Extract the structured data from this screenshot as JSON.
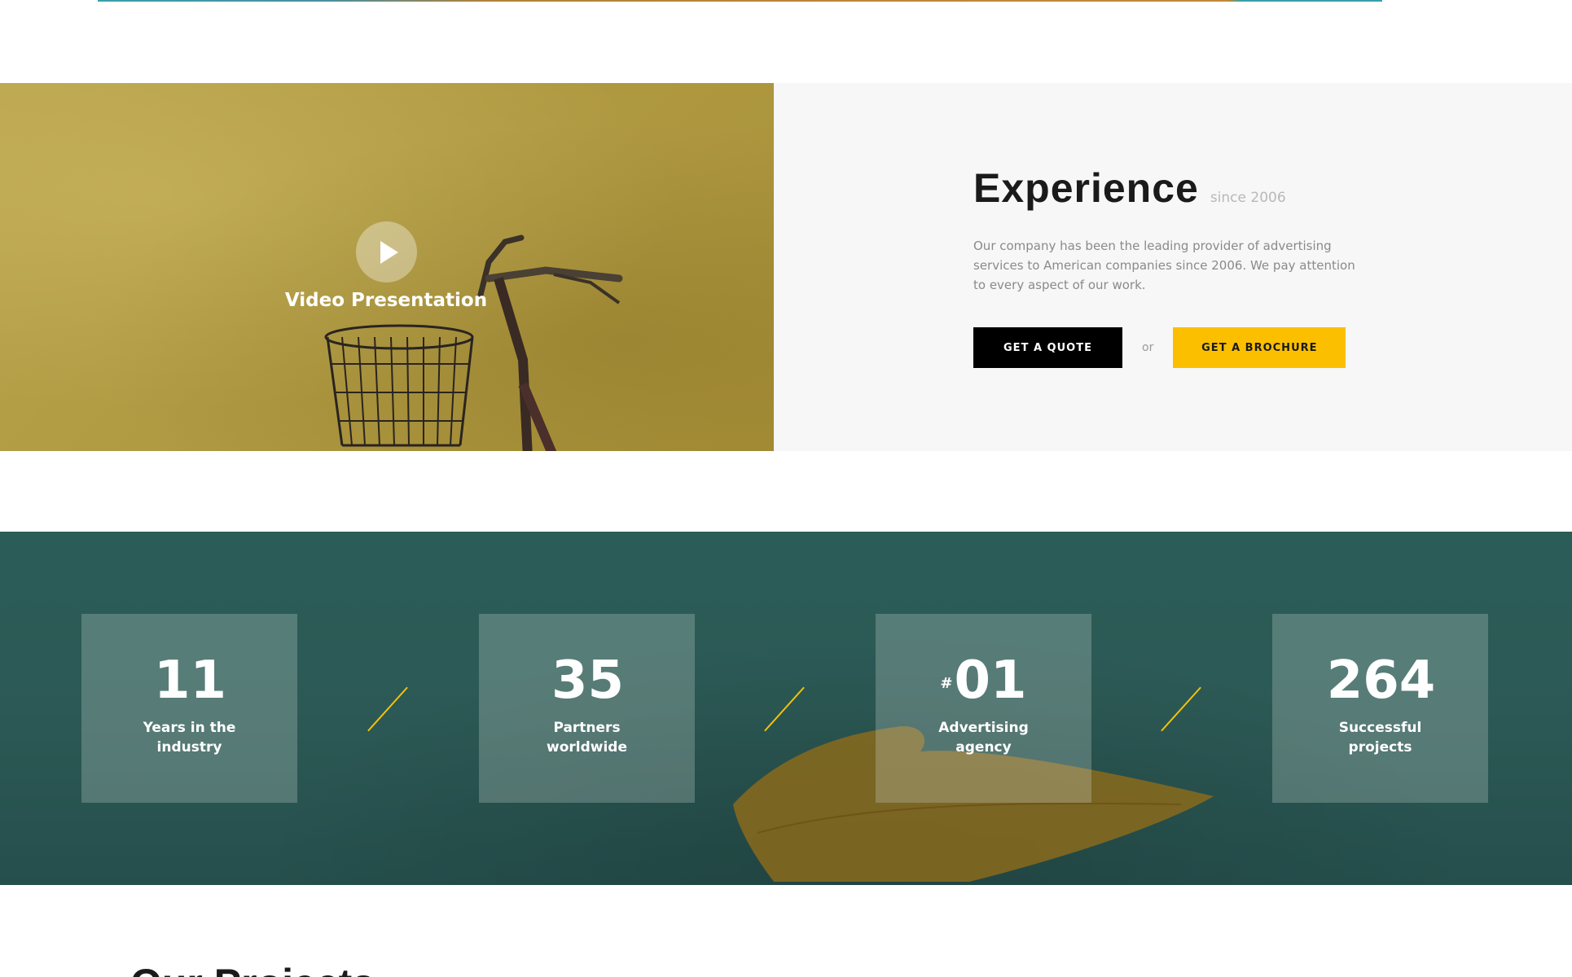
{
  "video": {
    "label": "Video Presentation",
    "play_icon": "play-icon"
  },
  "experience": {
    "title": "Experience",
    "since": "since 2006",
    "text": "Our company has been the leading provider of advertising services to American companies since 2006. We pay attention to every aspect of our work.",
    "quote_button": "GET A QUOTE",
    "or": "or",
    "brochure_button": "GET A BROCHURE"
  },
  "stats": [
    {
      "prefix": "",
      "number": "11",
      "label": "Years in the industry"
    },
    {
      "prefix": "",
      "number": "35",
      "label": "Partners worldwide"
    },
    {
      "prefix": "#",
      "number": "01",
      "label": "Advertising agency"
    },
    {
      "prefix": "",
      "number": "264",
      "label": "Successful projects"
    }
  ],
  "next_section": {
    "heading": "Our Projects"
  },
  "colors": {
    "accent": "#fcbf00",
    "button_dark": "#000000",
    "stats_bg": "#2b5d58",
    "video_bg": "#b09a42"
  }
}
